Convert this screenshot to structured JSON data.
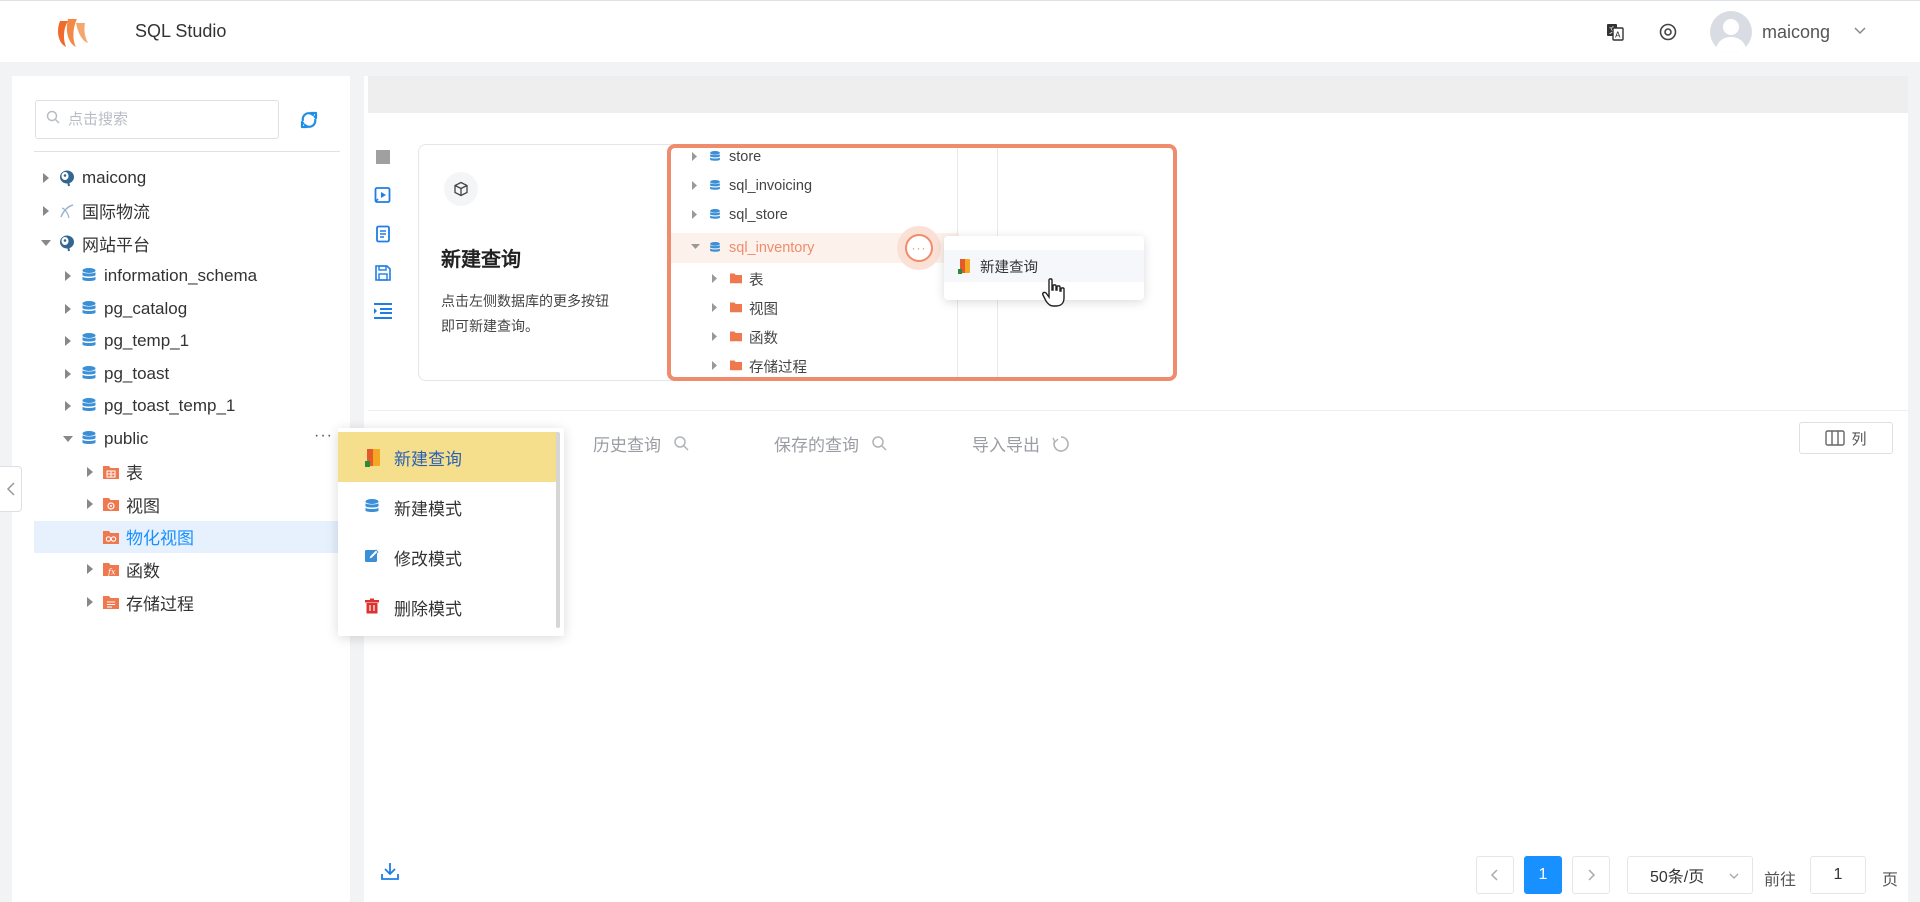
{
  "header": {
    "app_title": "SQL Studio",
    "user_name": "maicong"
  },
  "sidebar": {
    "search_placeholder": "点击搜索",
    "tree": [
      {
        "label": "maicong",
        "level": 0,
        "icon": "postgres-icon",
        "expanded": false
      },
      {
        "label": "国际物流",
        "level": 0,
        "icon": "connection-icon",
        "expanded": false
      },
      {
        "label": "网站平台",
        "level": 0,
        "icon": "postgres-icon",
        "expanded": true
      },
      {
        "label": "information_schema",
        "level": 1,
        "icon": "database-icon",
        "expanded": false
      },
      {
        "label": "pg_catalog",
        "level": 1,
        "icon": "database-icon",
        "expanded": false
      },
      {
        "label": "pg_temp_1",
        "level": 1,
        "icon": "database-icon",
        "expanded": false
      },
      {
        "label": "pg_toast",
        "level": 1,
        "icon": "database-icon",
        "expanded": false
      },
      {
        "label": "pg_toast_temp_1",
        "level": 1,
        "icon": "database-icon",
        "expanded": false
      },
      {
        "label": "public",
        "level": 1,
        "icon": "database-icon",
        "expanded": true
      },
      {
        "label": "表",
        "level": 2,
        "icon": "table-folder-icon",
        "expanded": false
      },
      {
        "label": "视图",
        "level": 2,
        "icon": "view-folder-icon",
        "expanded": false
      },
      {
        "label": "物化视图",
        "level": 2,
        "icon": "matview-folder-icon",
        "expanded": false,
        "selected": true
      },
      {
        "label": "函数",
        "level": 2,
        "icon": "function-folder-icon",
        "expanded": false
      },
      {
        "label": "存储过程",
        "level": 2,
        "icon": "procedure-folder-icon",
        "expanded": false
      }
    ]
  },
  "context_menu": {
    "items": [
      {
        "label": "新建查询",
        "icon": "new-query-icon"
      },
      {
        "label": "新建模式",
        "icon": "database-icon"
      },
      {
        "label": "修改模式",
        "icon": "edit-icon"
      },
      {
        "label": "删除模式",
        "icon": "trash-icon"
      }
    ]
  },
  "guide": {
    "title": "新建查询",
    "desc_line1": "点击左侧数据库的更多按钮",
    "desc_line2": "即可新建查询。",
    "image_rows": [
      "store",
      "sql_invoicing",
      "sql_store",
      "sql_inventory",
      "表",
      "视图",
      "函数",
      "存储过程"
    ],
    "image_popup": "新建查询"
  },
  "tabs": {
    "history": "历史查询",
    "saved": "保存的查询",
    "import_export": "导入导出",
    "columns": "列"
  },
  "pagination": {
    "current_page": "1",
    "page_size": "50条/页",
    "goto_prefix": "前往",
    "goto_value": "1",
    "goto_suffix": "页"
  },
  "colors": {
    "accent": "#1890ff",
    "menu_highlight": "#f5df8c",
    "guide_border": "#ef8c6d",
    "db_icon": "#3a8fd6",
    "folder_icon": "#f0784e"
  }
}
